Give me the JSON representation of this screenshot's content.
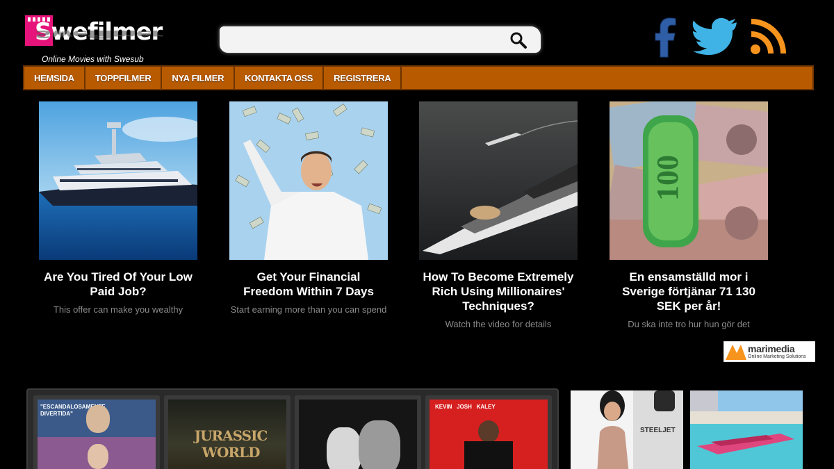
{
  "header": {
    "logo_text": "Swefilmer",
    "logo_tagline": "Online Movies with Swesub",
    "search": {
      "value": "",
      "placeholder": ""
    },
    "social": [
      "facebook-icon",
      "twitter-icon",
      "rss-icon"
    ]
  },
  "nav": {
    "items": [
      {
        "label": "HEMSIDA"
      },
      {
        "label": "TOPPFILMER"
      },
      {
        "label": "NYA FILMER"
      },
      {
        "label": "KONTAKTA OSS"
      },
      {
        "label": "REGISTRERA"
      }
    ]
  },
  "ads": [
    {
      "title": "Are You Tired Of Your Low Paid Job?",
      "subtitle": "This offer can make you wealthy"
    },
    {
      "title": "Get Your Financial Freedom Within 7 Days",
      "subtitle": "Start earning more than you can spend"
    },
    {
      "title": "How To Become Extremely Rich Using Millionaires' Techniques?",
      "subtitle": "Watch the video for details"
    },
    {
      "title": "En ensamställd mor i Sverige förtjänar 71 130 SEK per år!",
      "subtitle": "Du ska inte tro hur hun gör det"
    }
  ],
  "ad_network": {
    "name": "marimedia",
    "tagline": "Online Marketing Solutions"
  },
  "posters": [
    {
      "text": "\"ESCANDALOSAMENTE DIVERTIDA\""
    },
    {
      "text": "JURASSIC WORLD"
    },
    {
      "text": ""
    },
    {
      "text": "KEVIN   JOSH   KALEY"
    }
  ],
  "colors": {
    "nav_bg": "#b75a00",
    "logo_pink": "#e6137a",
    "accent": "#f7941d"
  }
}
